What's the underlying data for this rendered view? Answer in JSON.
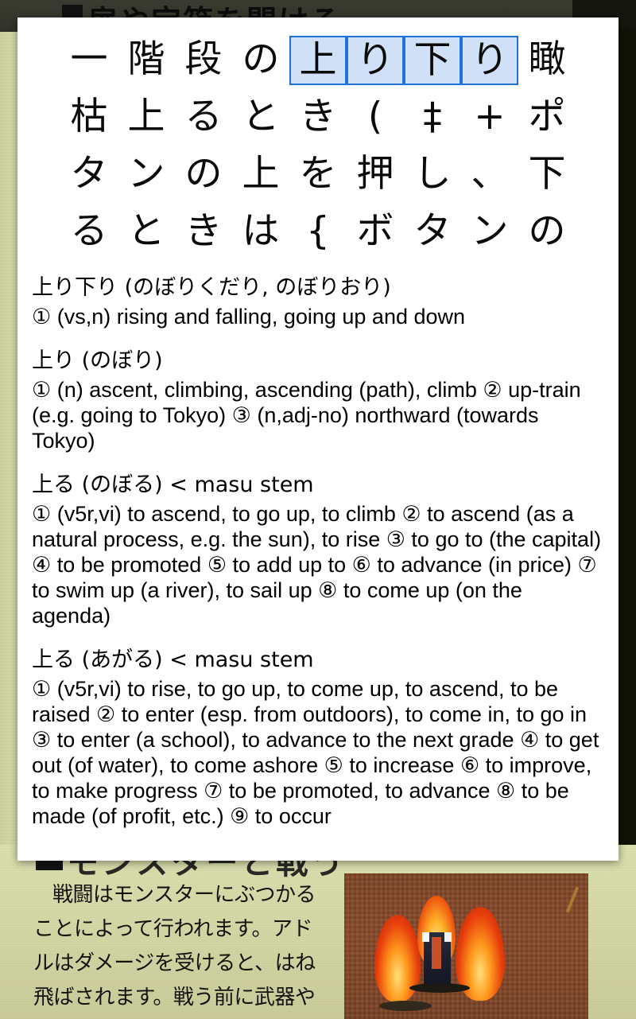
{
  "app": {
    "type": "camera-ocr-dictionary-overlay"
  },
  "background": {
    "top_band_text": "扉や宝箱を開ける",
    "manual_heading": "モンスターと戦う",
    "manual_body_lines": [
      "戦闘はモンスターにぶつかる",
      "ことによって行われます。アド",
      "ルはダメージを受けると、はね",
      "飛ばされます。戦う前に武器や"
    ],
    "paper_color": "#d4d7a5",
    "dark_color": "#15160f",
    "game_ground_color": "#81472a"
  },
  "colors": {
    "card_background": "#ffffff",
    "selection_fill": "#cfe0f7",
    "selection_border": "#1f72d4",
    "text": "#000000"
  },
  "ocr": {
    "selected_text": "上り下り",
    "rows": [
      [
        {
          "ch": "一",
          "selected": false
        },
        {
          "ch": "階",
          "selected": false
        },
        {
          "ch": "段",
          "selected": false
        },
        {
          "ch": "の",
          "selected": false
        },
        {
          "ch": "上",
          "selected": true
        },
        {
          "ch": "り",
          "selected": true
        },
        {
          "ch": "下",
          "selected": true
        },
        {
          "ch": "り",
          "selected": true
        },
        {
          "ch": "瞰",
          "selected": false
        }
      ],
      [
        {
          "ch": "枯",
          "selected": false
        },
        {
          "ch": "上",
          "selected": false
        },
        {
          "ch": "る",
          "selected": false
        },
        {
          "ch": "と",
          "selected": false
        },
        {
          "ch": "き",
          "selected": false
        },
        {
          "ch": "(",
          "selected": false
        },
        {
          "ch": "‡",
          "selected": false
        },
        {
          "ch": "+",
          "selected": false
        },
        {
          "ch": "ポ",
          "selected": false
        }
      ],
      [
        {
          "ch": "タ",
          "selected": false
        },
        {
          "ch": "ン",
          "selected": false
        },
        {
          "ch": "の",
          "selected": false
        },
        {
          "ch": "上",
          "selected": false
        },
        {
          "ch": "を",
          "selected": false
        },
        {
          "ch": "押",
          "selected": false
        },
        {
          "ch": "し",
          "selected": false
        },
        {
          "ch": "、",
          "selected": false
        },
        {
          "ch": "下",
          "selected": false
        }
      ],
      [
        {
          "ch": "る",
          "selected": false
        },
        {
          "ch": "と",
          "selected": false
        },
        {
          "ch": "き",
          "selected": false
        },
        {
          "ch": "は",
          "selected": false
        },
        {
          "ch": "{",
          "selected": false
        },
        {
          "ch": "ボ",
          "selected": false
        },
        {
          "ch": "タ",
          "selected": false
        },
        {
          "ch": "ン",
          "selected": false
        },
        {
          "ch": "の",
          "selected": false
        }
      ]
    ]
  },
  "entries": [
    {
      "headword": "上り下り (のぼりくだり, のぼりおり)",
      "glosses": "① (vs,n) rising and falling, going up and down"
    },
    {
      "headword": "上り (のぼり)",
      "glosses": "① (n) ascent, climbing, ascending (path), climb ② up-train (e.g. going to Tokyo) ③ (n,adj-no) northward (towards Tokyo)"
    },
    {
      "headword": "上る (のぼる) < masu stem",
      "glosses": "① (v5r,vi) to ascend, to go up, to climb ② to ascend (as a natural process, e.g. the sun), to rise ③ to go to (the capital) ④ to be promoted ⑤ to add up to ⑥ to advance (in price) ⑦ to swim up (a river), to sail up ⑧ to come up (on the agenda)"
    },
    {
      "headword": "上る (あがる) < masu stem",
      "glosses": "① (v5r,vi) to rise, to go up, to come up, to ascend, to be raised ② to enter (esp. from outdoors), to come in, to go in ③ to enter (a school), to advance to the next grade ④ to get out (of water), to come ashore ⑤ to increase ⑥ to improve, to make progress ⑦ to be promoted, to advance ⑧ to be made (of profit, etc.) ⑨ to occur"
    }
  ]
}
